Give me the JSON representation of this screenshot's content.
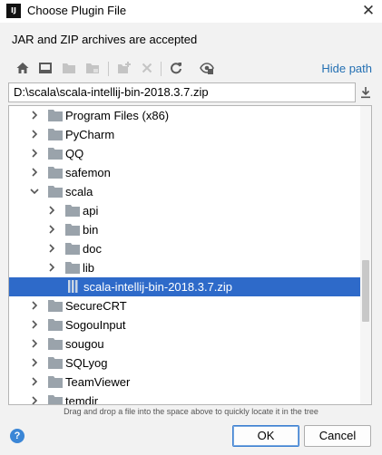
{
  "window": {
    "title": "Choose Plugin File",
    "app_icon_text": "IJ",
    "close_glyph": "✕"
  },
  "subtitle": "JAR and ZIP archives are accepted",
  "toolbar": {
    "icons": [
      "home-icon",
      "desktop-icon",
      "project-folder-icon",
      "module-folder-icon",
      "new-folder-icon",
      "delete-icon",
      "refresh-icon",
      "show-hidden-icon"
    ],
    "hide_path_label": "Hide path"
  },
  "path": {
    "value": "D:\\scala\\scala-intellij-bin-2018.3.7.zip"
  },
  "tree": {
    "rows": [
      {
        "label": "Program Files (x86)",
        "level": 0,
        "expanded": false,
        "type": "folder",
        "selected": false
      },
      {
        "label": "PyCharm",
        "level": 0,
        "expanded": false,
        "type": "folder",
        "selected": false
      },
      {
        "label": "QQ",
        "level": 0,
        "expanded": false,
        "type": "folder",
        "selected": false
      },
      {
        "label": "safemon",
        "level": 0,
        "expanded": false,
        "type": "folder",
        "selected": false
      },
      {
        "label": "scala",
        "level": 0,
        "expanded": true,
        "type": "folder",
        "selected": false
      },
      {
        "label": "api",
        "level": 1,
        "expanded": false,
        "type": "folder",
        "selected": false
      },
      {
        "label": "bin",
        "level": 1,
        "expanded": false,
        "type": "folder",
        "selected": false
      },
      {
        "label": "doc",
        "level": 1,
        "expanded": false,
        "type": "folder",
        "selected": false
      },
      {
        "label": "lib",
        "level": 1,
        "expanded": false,
        "type": "folder",
        "selected": false
      },
      {
        "label": "scala-intellij-bin-2018.3.7.zip",
        "level": 1,
        "expanded": false,
        "type": "archive",
        "selected": true
      },
      {
        "label": "SecureCRT",
        "level": 0,
        "expanded": false,
        "type": "folder",
        "selected": false
      },
      {
        "label": "SogouInput",
        "level": 0,
        "expanded": false,
        "type": "folder",
        "selected": false
      },
      {
        "label": "sougou",
        "level": 0,
        "expanded": false,
        "type": "folder",
        "selected": false
      },
      {
        "label": "SQLyog",
        "level": 0,
        "expanded": false,
        "type": "folder",
        "selected": false
      },
      {
        "label": "TeamViewer",
        "level": 0,
        "expanded": false,
        "type": "folder",
        "selected": false
      },
      {
        "label": "temdir",
        "level": 0,
        "expanded": false,
        "type": "folder",
        "selected": false
      }
    ]
  },
  "hint": "Drag and drop a file into the space above to quickly locate it in the tree",
  "buttons": {
    "help": "?",
    "ok": "OK",
    "cancel": "Cancel"
  },
  "colors": {
    "selection": "#2e6ac9",
    "link": "#2470b3",
    "folder": "#9aa3ab"
  }
}
